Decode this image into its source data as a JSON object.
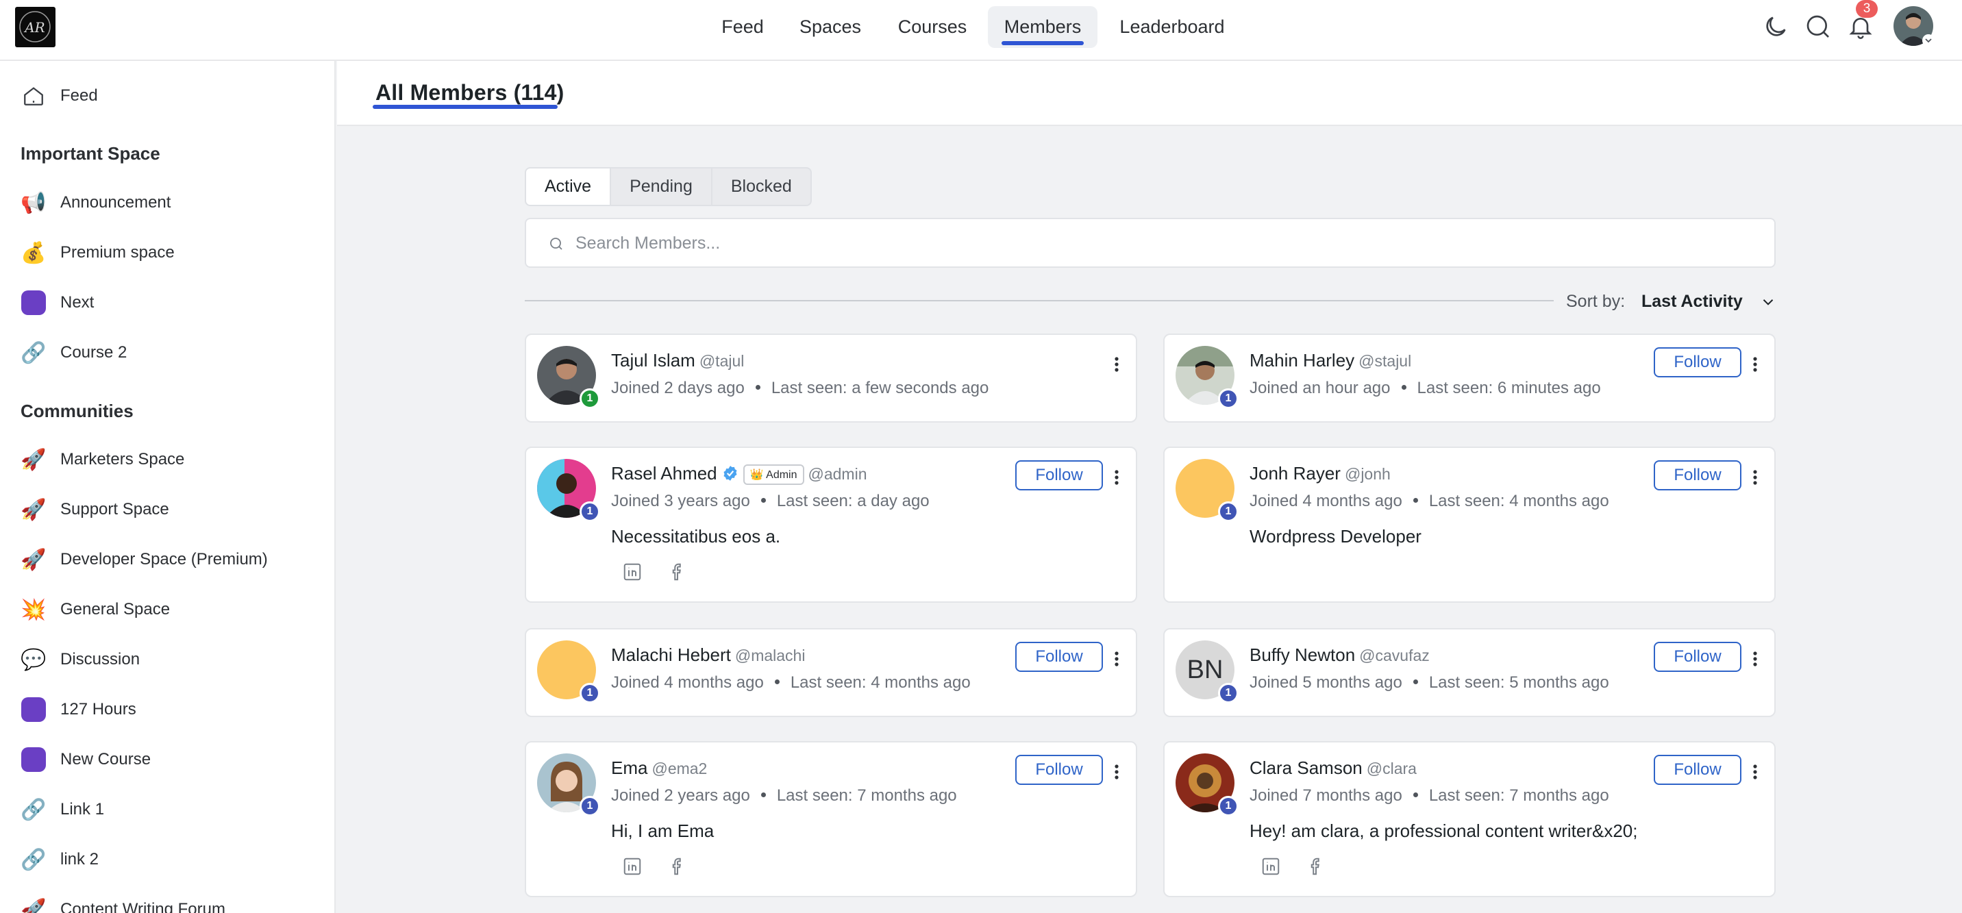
{
  "nav": {
    "items": [
      "Feed",
      "Spaces",
      "Courses",
      "Members",
      "Leaderboard"
    ],
    "active": "Members",
    "notifications_count": "3",
    "logo_text": "AR",
    "user_initial_chevron": "chevron-down-icon"
  },
  "sidebar": {
    "feed": "Feed",
    "important_heading": "Important Space",
    "important": [
      {
        "label": "Announcement",
        "icon": "📢"
      },
      {
        "label": "Premium space",
        "icon": "💰"
      },
      {
        "label": "Next",
        "icon": "dot"
      },
      {
        "label": "Course 2",
        "icon": "🔗"
      }
    ],
    "communities_heading": "Communities",
    "communities": [
      {
        "label": "Marketers Space",
        "icon": "🚀"
      },
      {
        "label": "Support Space",
        "icon": "🚀"
      },
      {
        "label": "Developer Space (Premium)",
        "icon": "🚀"
      },
      {
        "label": "General Space",
        "icon": "💥"
      },
      {
        "label": "Discussion",
        "icon": "💬"
      },
      {
        "label": "127 Hours",
        "icon": "dot"
      },
      {
        "label": "New Course",
        "icon": "dot"
      },
      {
        "label": "Link 1",
        "icon": "🔗"
      },
      {
        "label": "link 2",
        "icon": "🔗"
      },
      {
        "label": "Content Writing Forum",
        "icon": "🚀"
      }
    ]
  },
  "page": {
    "title": "All Members (114)"
  },
  "tabs": [
    "Active",
    "Pending",
    "Blocked"
  ],
  "search": {
    "placeholder": "Search Members..."
  },
  "sort": {
    "label": "Sort by:",
    "value": "Last Activity"
  },
  "follow_label": "Follow",
  "admin_badge": "Admin",
  "members": [
    {
      "name": "Tajul Islam",
      "handle": "@tajul",
      "joined": "Joined 2 days ago",
      "last_seen": "Last seen: a few seconds ago",
      "bio": "",
      "level": "1",
      "avatar": "photo",
      "follow": false,
      "socials": false
    },
    {
      "name": "Mahin Harley",
      "handle": "@stajul",
      "joined": "Joined an hour ago",
      "last_seen": "Last seen: 6 minutes ago",
      "bio": "",
      "level": "1",
      "avatar": "photo",
      "follow": true,
      "socials": false
    },
    {
      "name": "Rasel Ahmed",
      "handle": "@admin",
      "joined": "Joined 3 years ago",
      "last_seen": "Last seen: a day ago",
      "bio": "Necessitatibus eos a.",
      "level": "1",
      "avatar": "photo",
      "follow": true,
      "socials": true,
      "verified": true
    },
    {
      "name": "Jonh Rayer",
      "handle": "@jonh",
      "joined": "Joined 4 months ago",
      "last_seen": "Last seen: 4 months ago",
      "bio": "Wordpress Developer",
      "level": "1",
      "avatar": "yellow",
      "follow": true,
      "socials": false
    },
    {
      "name": "Malachi Hebert",
      "handle": "@malachi",
      "joined": "Joined 4 months ago",
      "last_seen": "Last seen: 4 months ago",
      "bio": "",
      "level": "1",
      "avatar": "yellow",
      "follow": true,
      "socials": false
    },
    {
      "name": "Buffy Newton",
      "handle": "@cavufaz",
      "joined": "Joined 5 months ago",
      "last_seen": "Last seen: 5 months ago",
      "bio": "",
      "level": "1",
      "avatar": "BN",
      "follow": true,
      "socials": false
    },
    {
      "name": "Ema",
      "handle": "@ema2",
      "joined": "Joined 2 years ago",
      "last_seen": "Last seen: 7 months ago",
      "bio": "Hi, I am Ema",
      "level": "1",
      "avatar": "photo",
      "follow": true,
      "socials": true
    },
    {
      "name": "Clara Samson",
      "handle": "@clara",
      "joined": "Joined 7 months ago",
      "last_seen": "Last seen: 7 months ago",
      "bio": "Hey! am clara, a professional content writer&x20;",
      "level": "1",
      "avatar": "photo",
      "follow": true,
      "socials": true
    }
  ]
}
